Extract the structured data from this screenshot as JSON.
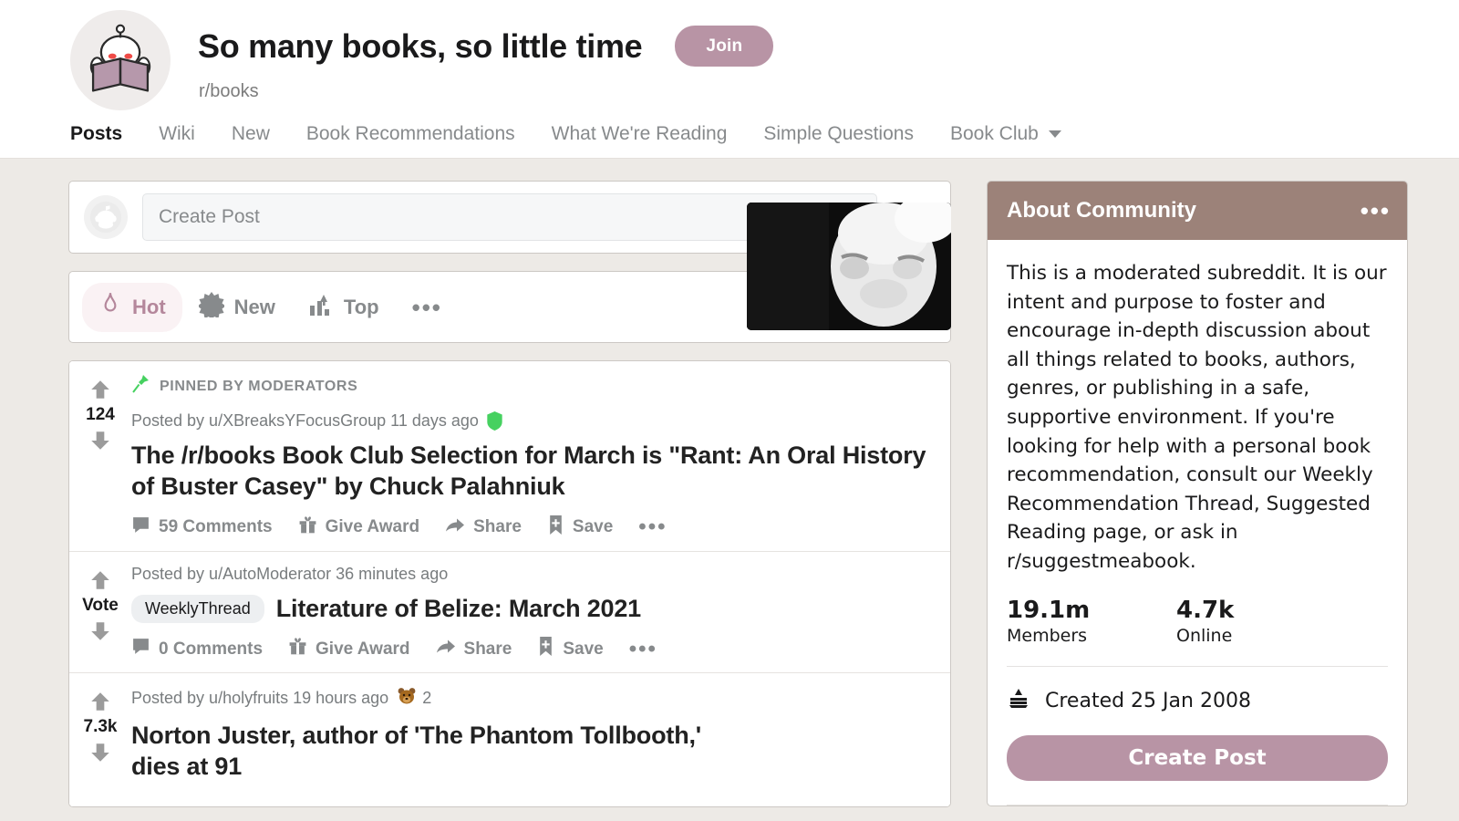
{
  "colors": {
    "accent": "#b894a5",
    "about_header": "#9c8279",
    "page_bg": "#edeae6",
    "muted_text": "#878a8c",
    "pinned_green": "#46d160"
  },
  "header": {
    "community_title": "So many books, so little time",
    "community_handle": "r/books",
    "join_label": "Join",
    "icon_name": "snoo-reading-book-icon",
    "tabs": [
      {
        "label": "Posts",
        "active": true
      },
      {
        "label": "Wiki",
        "active": false
      },
      {
        "label": "New",
        "active": false
      },
      {
        "label": "Book Recommendations",
        "active": false
      },
      {
        "label": "What We're Reading",
        "active": false
      },
      {
        "label": "Simple Questions",
        "active": false
      },
      {
        "label": "Book Club",
        "active": false,
        "caret": true
      }
    ]
  },
  "create_post": {
    "placeholder": "Create Post",
    "value": "",
    "link_icon": "link-icon",
    "avatar_icon": "snoo-avatar-icon"
  },
  "sort_bar": {
    "items": [
      {
        "label": "Hot",
        "icon": "flame-icon",
        "active": true
      },
      {
        "label": "New",
        "icon": "starburst-icon",
        "active": false
      },
      {
        "label": "Top",
        "icon": "bar-chart-up-icon",
        "active": false
      }
    ],
    "more_label": "•••",
    "view_mode_icon": "card-view-icon"
  },
  "posts": [
    {
      "score": "124",
      "pinned_label": "PINNED BY MODERATORS",
      "pinned_icon": "pin-icon",
      "meta": "Posted by u/XBreaksYFocusGroup 11 days ago",
      "badge_icon": "mod-shield-icon",
      "flair": "",
      "title": "The /r/books Book Club Selection for March is \"Rant: An Oral History of Buster Casey\" by Chuck Palahniuk",
      "comments": "59 Comments",
      "give_award": "Give Award",
      "share": "Share",
      "save": "Save",
      "more": "•••",
      "thumbnail": false
    },
    {
      "score": "Vote",
      "pinned_label": "",
      "meta": "Posted by u/AutoModerator 36 minutes ago",
      "flair": "WeeklyThread",
      "title": "Literature of Belize: March 2021",
      "comments": "0 Comments",
      "give_award": "Give Award",
      "share": "Share",
      "save": "Save",
      "more": "•••",
      "thumbnail": false
    },
    {
      "score": "7.3k",
      "pinned_label": "",
      "meta": "Posted by u/holyfruits 19 hours ago",
      "award_icon": "bear-award-icon",
      "award_count": "2",
      "flair": "",
      "title": "Norton Juster, author of 'The Phantom Tollbooth,' dies at 91",
      "comments": "",
      "give_award": "",
      "share": "",
      "save": "",
      "more": "",
      "thumbnail": true,
      "thumbnail_alt": "black-and-white-photo-of-elderly-man"
    }
  ],
  "sidebar": {
    "about": {
      "header_title": "About Community",
      "header_more": "•••",
      "description": "This is a moderated subreddit. It is our intent and purpose to foster and encourage in-depth discussion about all things related to books, authors, genres, or publishing in a safe, supportive environment. If you're looking for help with a personal book recommendation, consult our Weekly Recommendation Thread, Suggested Reading page, or ask in r/suggestmeabook.",
      "stats": [
        {
          "value": "19.1m",
          "label": "Members"
        },
        {
          "value": "4.7k",
          "label": "Online"
        }
      ],
      "created_icon": "cake-slice-icon",
      "created_text": "Created 25 Jan 2008",
      "create_post_label": "Create Post"
    }
  }
}
